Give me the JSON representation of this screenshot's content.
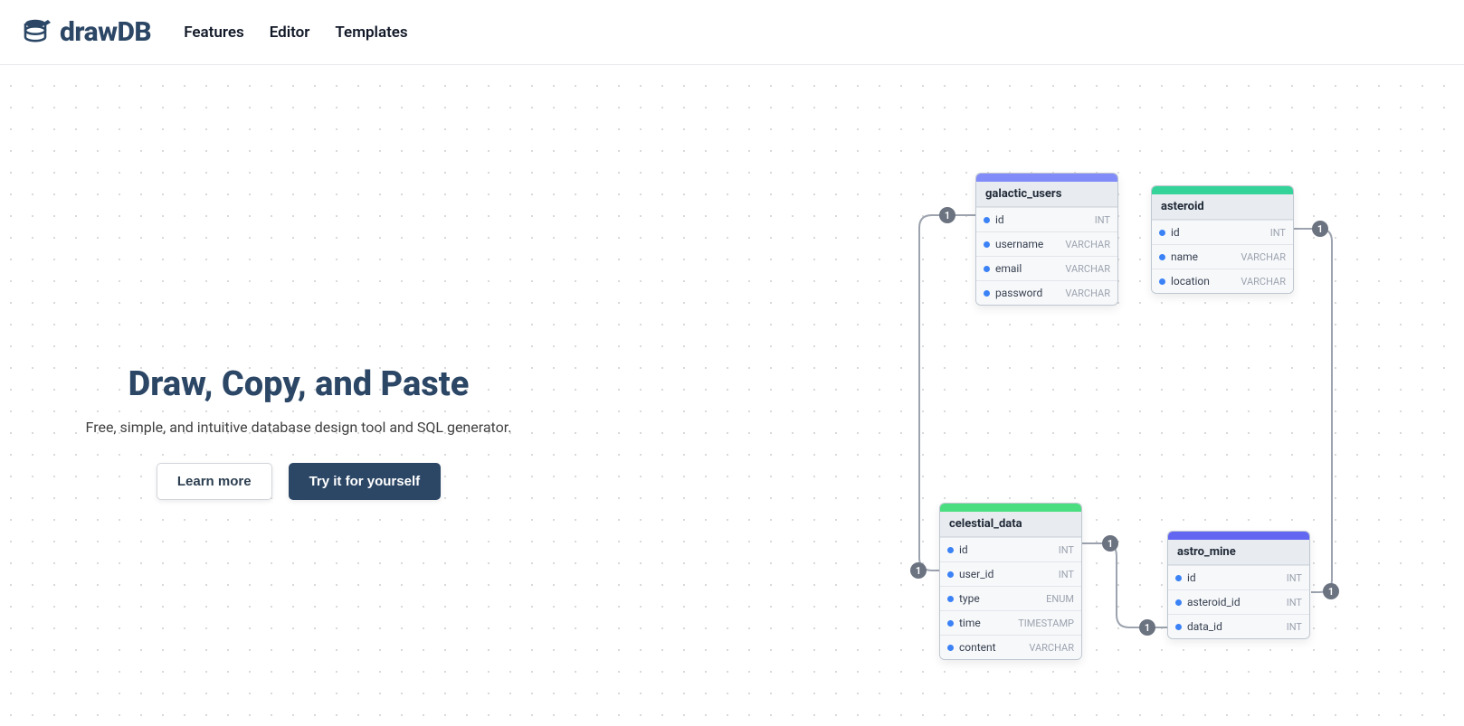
{
  "brand": "drawDB",
  "nav": {
    "features": "Features",
    "editor": "Editor",
    "templates": "Templates"
  },
  "hero": {
    "title": "Draw, Copy, and Paste",
    "subtitle": "Free, simple, and intuitive database design tool and SQL generator.",
    "secondary_btn": "Learn more",
    "primary_btn": "Try it for yourself"
  },
  "colors": {
    "blue": "#818cf8",
    "green": "#34d399",
    "green2": "#4ade80",
    "indigo": "#6366f1"
  },
  "tables": {
    "galactic_users": {
      "name": "galactic_users",
      "accent": "#818cf8",
      "fields": [
        {
          "name": "id",
          "type": "INT"
        },
        {
          "name": "username",
          "type": "VARCHAR"
        },
        {
          "name": "email",
          "type": "VARCHAR"
        },
        {
          "name": "password",
          "type": "VARCHAR"
        }
      ]
    },
    "asteroid": {
      "name": "asteroid",
      "accent": "#34d399",
      "fields": [
        {
          "name": "id",
          "type": "INT"
        },
        {
          "name": "name",
          "type": "VARCHAR"
        },
        {
          "name": "location",
          "type": "VARCHAR"
        }
      ]
    },
    "celestial_data": {
      "name": "celestial_data",
      "accent": "#4ade80",
      "fields": [
        {
          "name": "id",
          "type": "INT"
        },
        {
          "name": "user_id",
          "type": "INT"
        },
        {
          "name": "type",
          "type": "ENUM"
        },
        {
          "name": "time",
          "type": "TIMESTAMP"
        },
        {
          "name": "content",
          "type": "VARCHAR"
        }
      ]
    },
    "astro_mine": {
      "name": "astro_mine",
      "accent": "#6366f1",
      "fields": [
        {
          "name": "id",
          "type": "INT"
        },
        {
          "name": "asteroid_id",
          "type": "INT"
        },
        {
          "name": "data_id",
          "type": "INT"
        }
      ]
    }
  },
  "badge_label": "1"
}
